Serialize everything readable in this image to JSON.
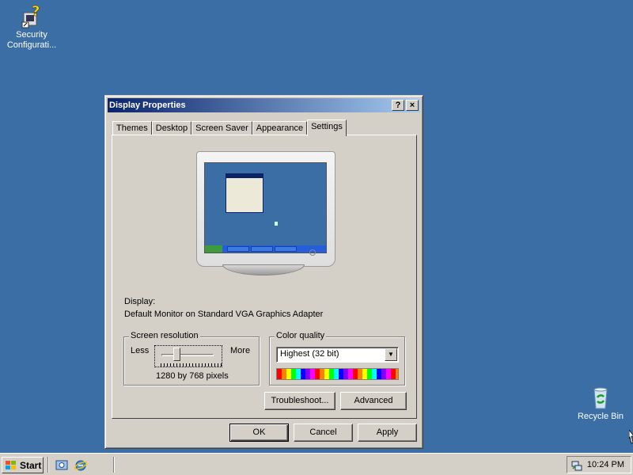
{
  "desktop": {
    "icons": [
      {
        "label": "Security\nConfigurati..."
      },
      {
        "label": "Recycle Bin"
      }
    ]
  },
  "dialog": {
    "title": "Display Properties",
    "help_glyph": "?",
    "close_glyph": "×",
    "tabs": [
      {
        "label": "Themes"
      },
      {
        "label": "Desktop"
      },
      {
        "label": "Screen Saver"
      },
      {
        "label": "Appearance"
      },
      {
        "label": "Settings",
        "active": true
      }
    ],
    "display_label": "Display:",
    "display_value": "Default Monitor on Standard VGA Graphics Adapter",
    "screen_resolution": {
      "title": "Screen resolution",
      "less": "Less",
      "more": "More",
      "value": "1280 by 768 pixels"
    },
    "color_quality": {
      "title": "Color quality",
      "selected": "Highest (32 bit)"
    },
    "buttons": {
      "troubleshoot": "Troubleshoot...",
      "advanced": "Advanced",
      "ok": "OK",
      "cancel": "Cancel",
      "apply": "Apply"
    }
  },
  "taskbar": {
    "start_label": "Start",
    "clock": "10:24 PM"
  }
}
